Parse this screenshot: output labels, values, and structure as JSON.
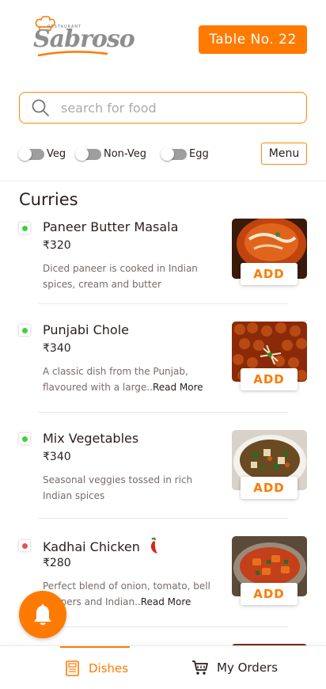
{
  "header": {
    "logo_small": "RESTAURANT",
    "logo_text": "Sabroso",
    "table_label": "Table No. 22"
  },
  "search": {
    "placeholder": "search for food"
  },
  "filters": {
    "toggles": [
      {
        "label": "Veg"
      },
      {
        "label": "Non-Veg"
      },
      {
        "label": "Egg"
      }
    ],
    "menu_label": "Menu"
  },
  "section": {
    "title": "Curries"
  },
  "items": [
    {
      "name": "Paneer Butter Masala",
      "price": "₹320",
      "desc": "Diced paneer is cooked in Indian spices, cream and butter",
      "read_more": "",
      "type": "veg",
      "dot_color": "#3dd13d",
      "add": "ADD"
    },
    {
      "name": "Punjabi Chole",
      "price": "₹340",
      "desc": "A classic dish from the Punjab, flavoured with a large..",
      "read_more": "Read More",
      "type": "veg",
      "dot_color": "#3dd13d",
      "add": "ADD"
    },
    {
      "name": "Mix Vegetables",
      "price": "₹340",
      "desc": "Seasonal veggies tossed in rich Indian spices",
      "read_more": "",
      "type": "veg",
      "dot_color": "#3dd13d",
      "add": "ADD"
    },
    {
      "name": "Kadhai Chicken",
      "price": "₹280",
      "desc": "Perfect blend of onion, tomato, bell peppers and Indian..",
      "read_more": "Read More",
      "type": "non-veg",
      "dot_color": "#e05555",
      "add": "ADD"
    }
  ],
  "bottom_nav": {
    "dishes": "Dishes",
    "orders": "My Orders"
  },
  "colors": {
    "accent": "#ff7a00",
    "veg": "#3dd13d",
    "non_veg": "#e05555"
  }
}
